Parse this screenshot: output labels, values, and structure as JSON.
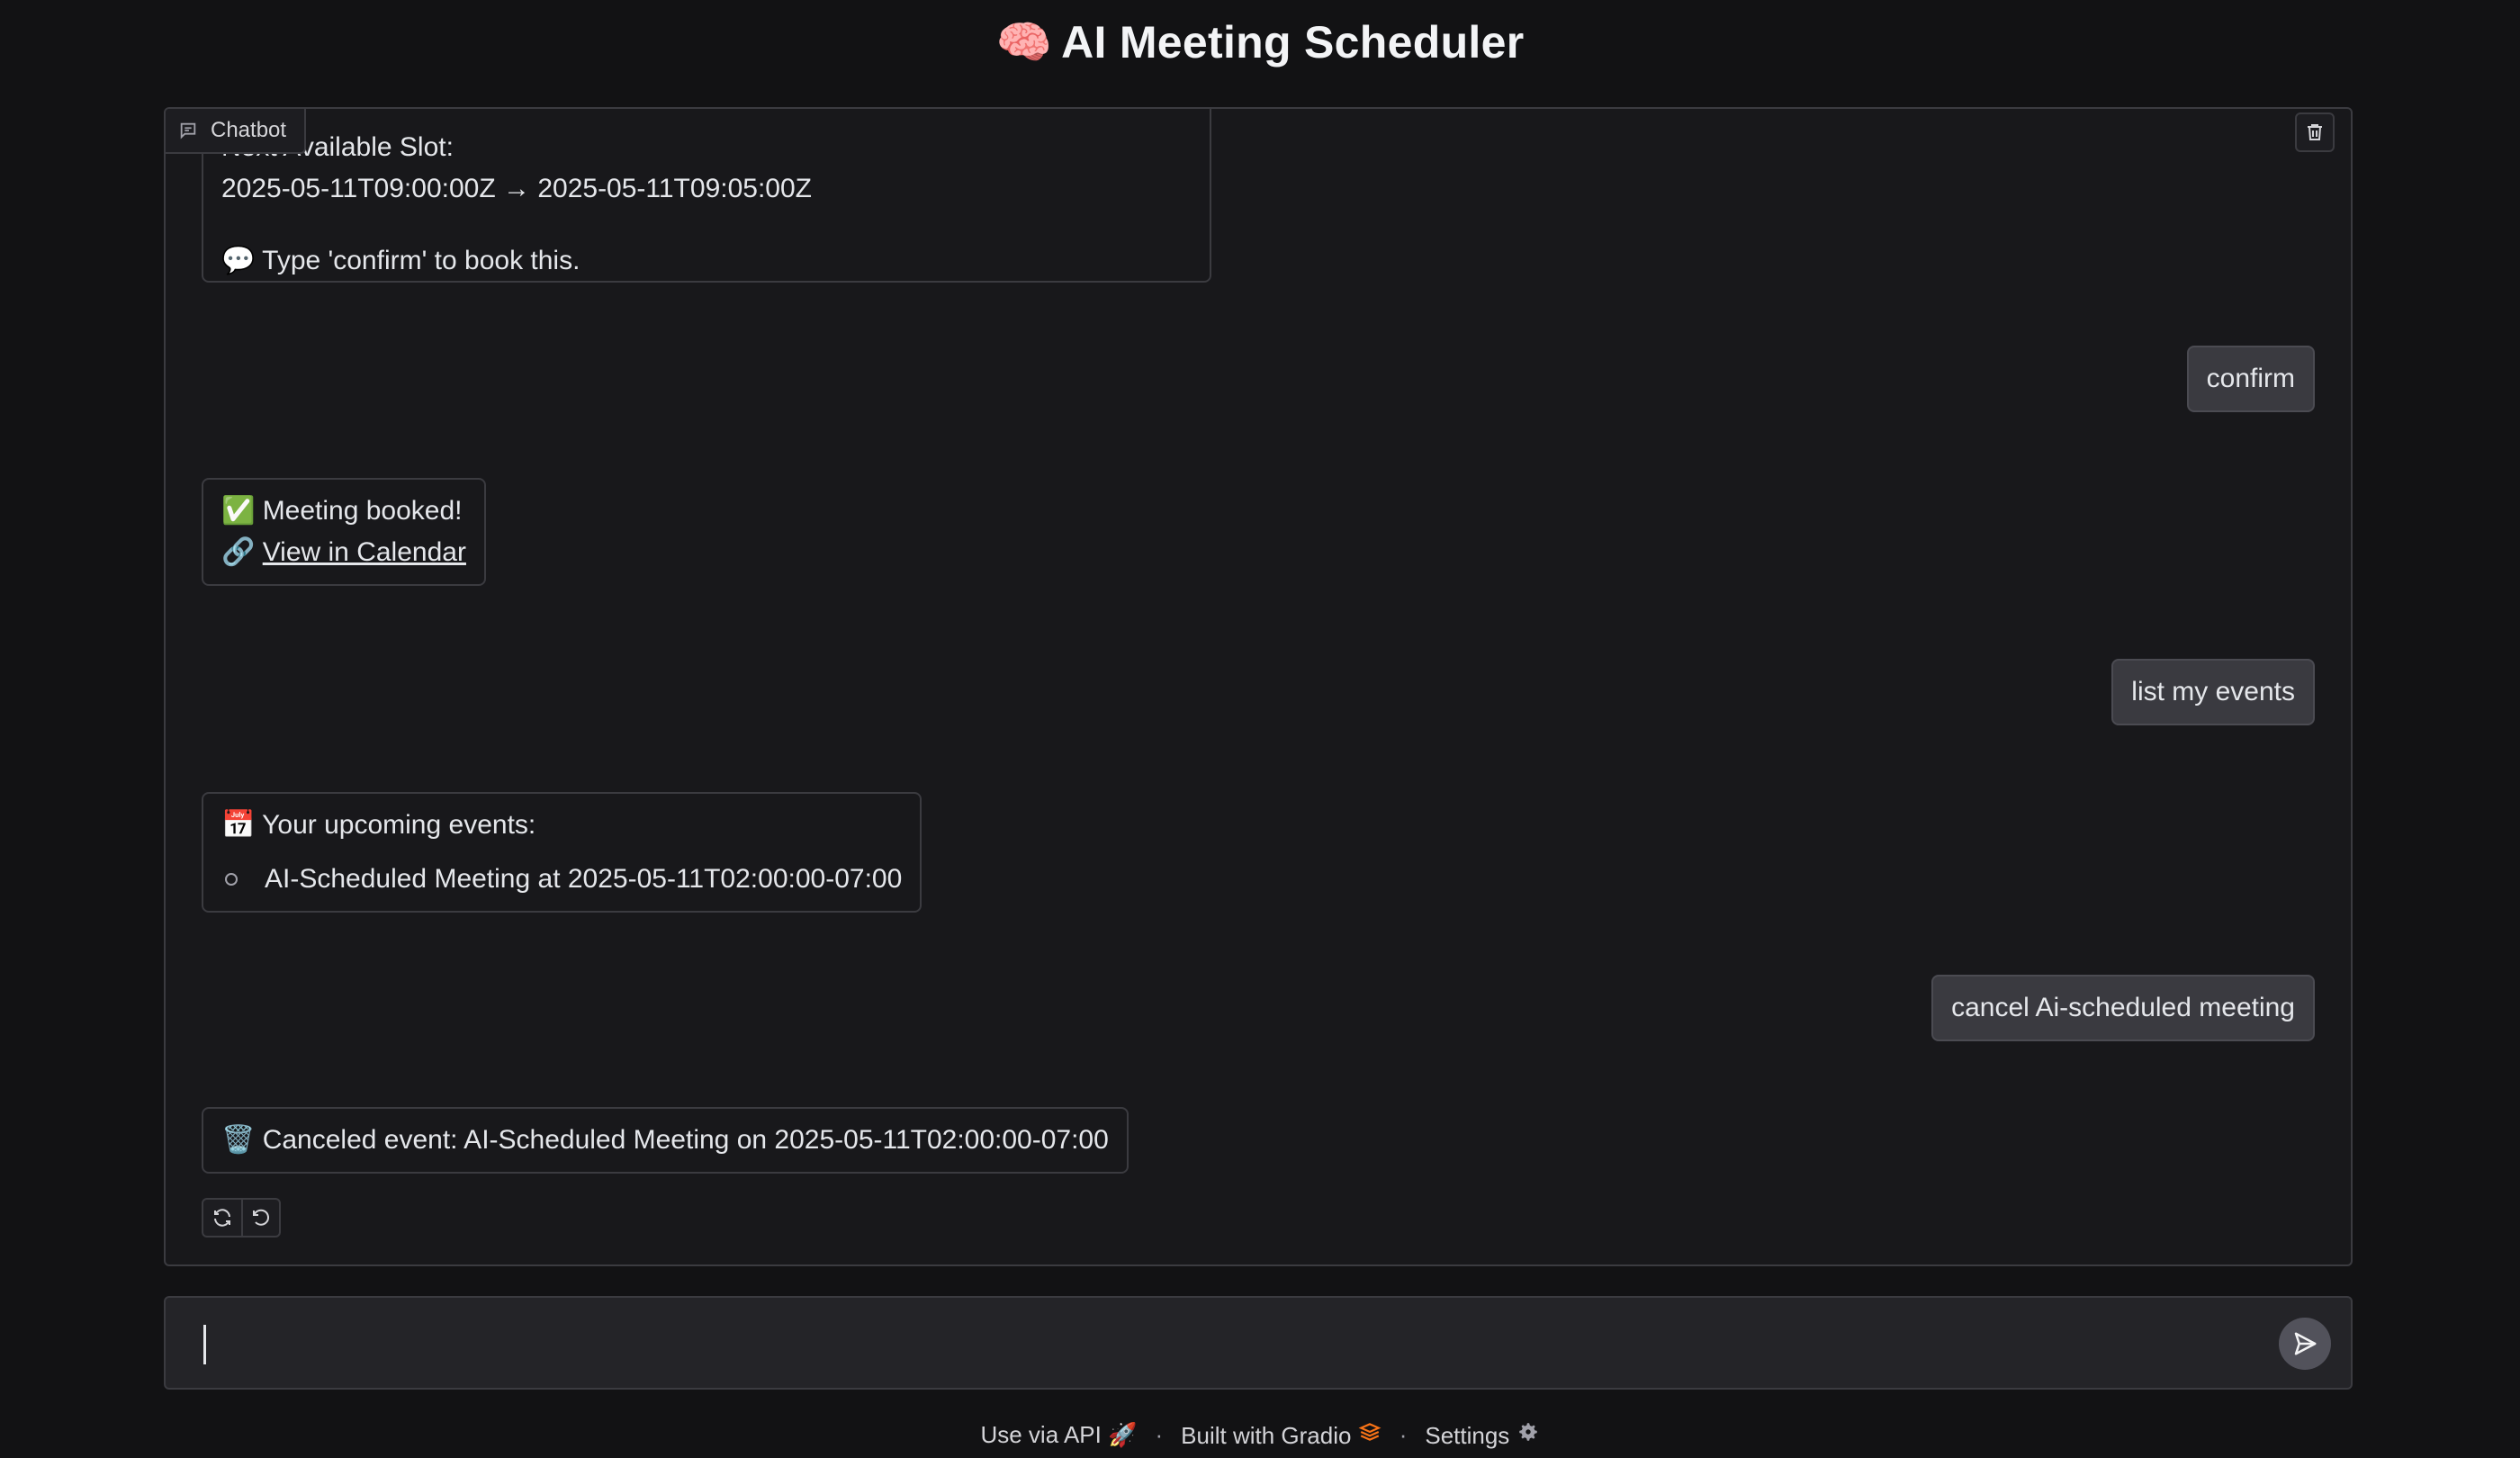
{
  "app": {
    "title": "AI Meeting Scheduler",
    "title_emoji": "🧠"
  },
  "chat": {
    "label": "Chatbot",
    "messages": [
      {
        "role": "bot",
        "lines": [
          "Next Available Slot:",
          "2025-05-11T09:00:00Z → 2025-05-11T09:05:00Z",
          "",
          "💬 Type 'confirm' to book this."
        ]
      },
      {
        "role": "user",
        "text": "confirm"
      },
      {
        "role": "bot",
        "line1": "✅ Meeting booked!",
        "link_prefix": "🔗 ",
        "link_text": "View in Calendar"
      },
      {
        "role": "user",
        "text": "list my events"
      },
      {
        "role": "bot",
        "heading": "📅 Your upcoming events:",
        "items": [
          "AI-Scheduled Meeting at 2025-05-11T02:00:00-07:00"
        ]
      },
      {
        "role": "user",
        "text": "cancel Ai-scheduled meeting"
      },
      {
        "role": "bot",
        "text": "🗑️ Canceled event: AI-Scheduled Meeting on 2025-05-11T02:00:00-07:00"
      }
    ]
  },
  "input": {
    "value": "",
    "placeholder": ""
  },
  "footer": {
    "api": "Use via API",
    "api_icon": "🚀",
    "built": "Built with Gradio",
    "settings": "Settings",
    "separator": "·"
  }
}
